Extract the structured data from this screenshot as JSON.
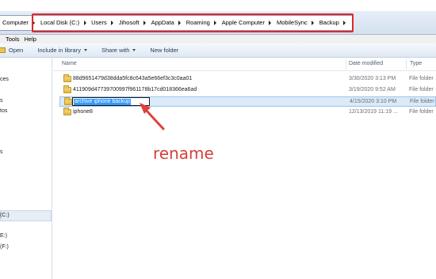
{
  "address": {
    "crumbs": [
      "Computer",
      "Local Disk (C:)",
      "Users",
      "Jihosoft",
      "AppData",
      "Roaming",
      "Apple Computer",
      "MobileSync",
      "Backup"
    ]
  },
  "menu": {
    "tools_label": "Tools",
    "help_label": "Help"
  },
  "toolbar": {
    "open_label": "Open",
    "include_label": "Include in library",
    "share_label": "Share with",
    "new_folder_label": "New folder"
  },
  "nav": {
    "items": [
      "ces",
      "s",
      "tos",
      "s",
      "(C:)",
      "E:)",
      "(F:)"
    ]
  },
  "columns": {
    "name": "Name",
    "date": "Date modified",
    "type": "Type"
  },
  "files": [
    {
      "name": "88d9651479d38dda5fc8c643a5e66ef3c3c0aa01",
      "date": "3/30/2020 3:13 PM",
      "type": "File folder"
    },
    {
      "name": "411909d47739700997f961178b17cd018366ea6ad",
      "date": "3/19/2020 9:52 AM",
      "type": "File folder"
    },
    {
      "name": "archive iphone backup",
      "date": "4/15/2020 3:10 PM",
      "type": "File folder",
      "renaming": true
    },
    {
      "name": "iphone8",
      "date": "12/13/2019 11:19 ...",
      "type": "File folder"
    }
  ],
  "annotation": {
    "text": "rename",
    "color": "#d6403c",
    "highlight_color": "#e0272a"
  }
}
